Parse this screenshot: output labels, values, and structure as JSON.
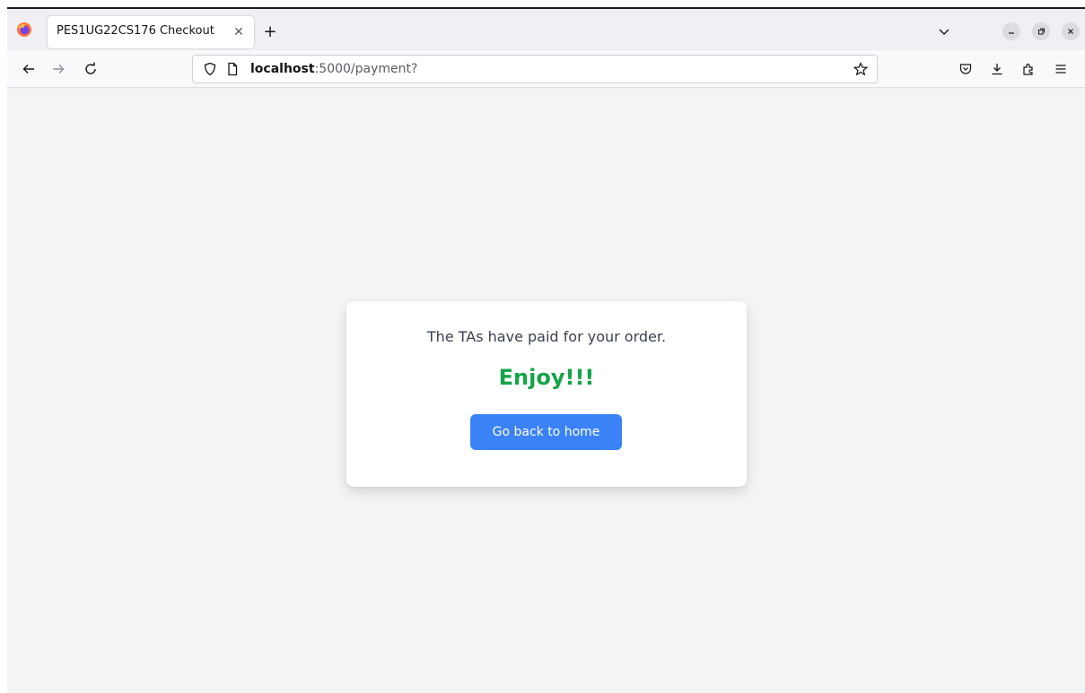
{
  "browser": {
    "tab_title": "PES1UG22CS176 Checkout",
    "url_host": "localhost",
    "url_rest": ":5000/payment?"
  },
  "page": {
    "message": "The TAs have paid for your order.",
    "headline": "Enjoy!!!",
    "home_button_label": "Go back to home"
  },
  "colors": {
    "background": "#f3f4f6",
    "headline": "#16a34a",
    "button": "#3b82f6"
  }
}
